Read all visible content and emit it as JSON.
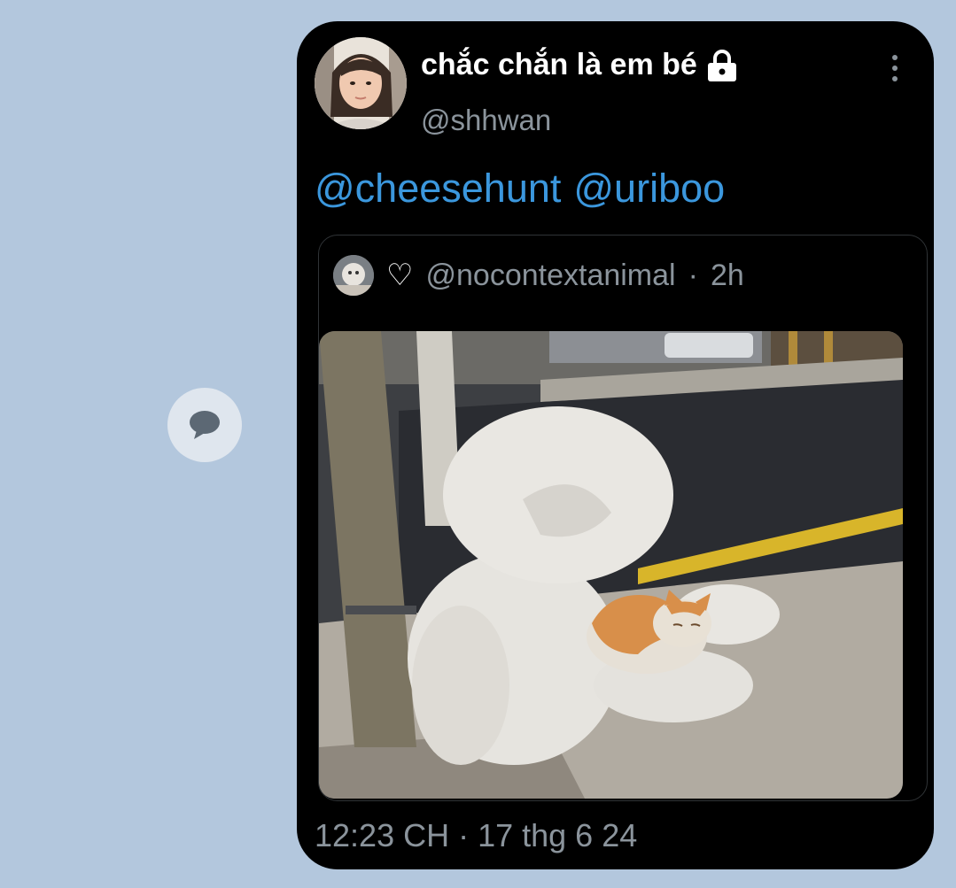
{
  "share_button": {
    "icon": "speech-bubble-icon"
  },
  "tweet": {
    "author": {
      "display_name": "chắc chắn là em bé",
      "handle": "@shhwan",
      "badge_icon": "lock-icon"
    },
    "menu_icon": "more-vertical-icon",
    "mentions": [
      "@cheesehunt",
      "@uriboo"
    ],
    "quoted": {
      "heart_glyph": "♡",
      "handle": "@nocontextanimal",
      "separator": "·",
      "age": "2h"
    },
    "timestamp": "12:23 CH · 17 thg 6 24"
  }
}
